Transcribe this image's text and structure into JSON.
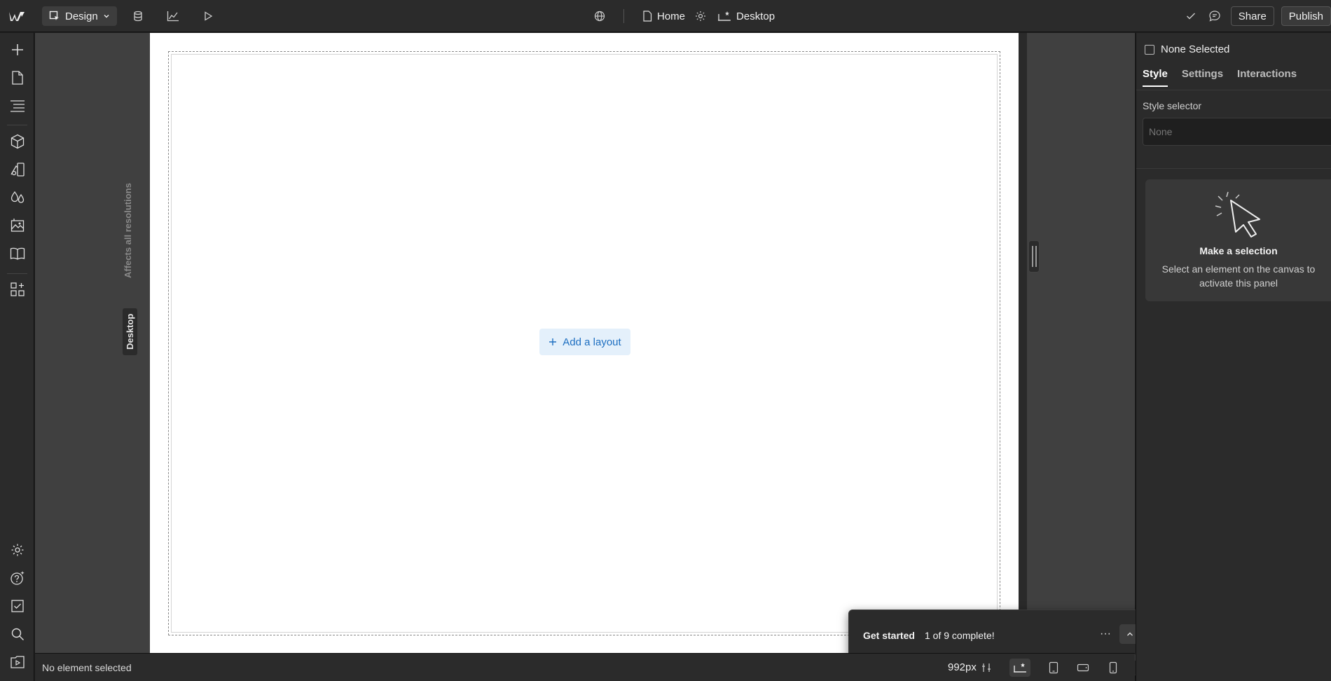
{
  "topbar": {
    "mode_label": "Design",
    "page_label": "Home",
    "breakpoint_label": "Desktop",
    "share_label": "Share",
    "publish_label": "Publish"
  },
  "canvas": {
    "add_layout_label": "Add a layout",
    "affects_label": "Affects all resolutions",
    "breakpoint_tag": "Desktop"
  },
  "statusbar": {
    "selection_text": "No element selected",
    "width_readout": "992px"
  },
  "get_started": {
    "title": "Get started",
    "progress_text": "1 of 9 complete!",
    "progress_fraction": 0.1111,
    "accent_color": "#1e88e5"
  },
  "right_panel": {
    "none_selected_label": "None Selected",
    "tabs": [
      {
        "label": "Style",
        "active": true
      },
      {
        "label": "Settings",
        "active": false
      },
      {
        "label": "Interactions",
        "active": false
      }
    ],
    "style_selector_label": "Style selector",
    "style_selector_placeholder": "None",
    "selection_title": "Make a selection",
    "selection_desc": "Select an element on the canvas to activate this panel"
  }
}
